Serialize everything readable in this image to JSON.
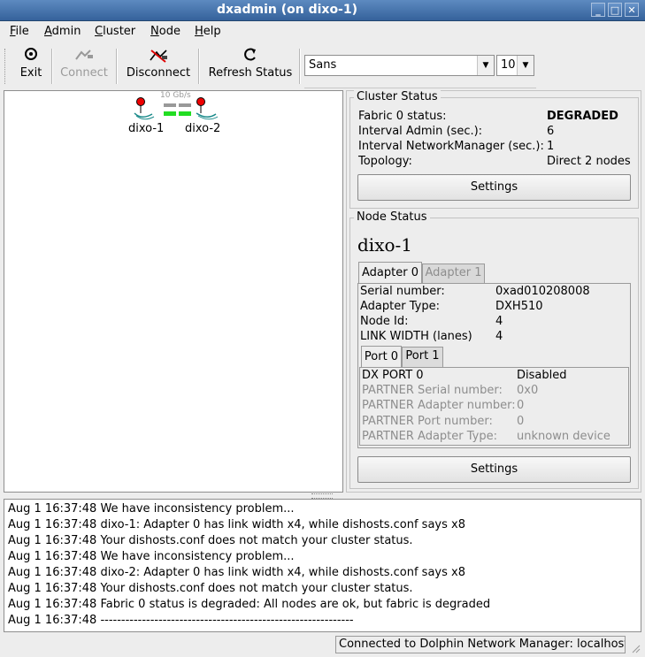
{
  "window": {
    "title": "dxadmin (on dixo-1)"
  },
  "menu": [
    {
      "mnemonic": "F",
      "rest": "ile"
    },
    {
      "mnemonic": "A",
      "rest": "dmin"
    },
    {
      "mnemonic": "C",
      "rest": "luster"
    },
    {
      "mnemonic": "N",
      "rest": "ode"
    },
    {
      "mnemonic": "H",
      "rest": "elp"
    }
  ],
  "toolbar": {
    "exit": "Exit",
    "connect": "Connect",
    "disconnect": "Disconnect",
    "refresh": "Refresh Status",
    "font_family": "Sans",
    "font_size": "10"
  },
  "topology": {
    "link_label": "10 Gb/s",
    "node1": "dixo-1",
    "node2": "dixo-2",
    "link_color": "#22dd22"
  },
  "cluster_status": {
    "title": "Cluster Status",
    "rows": [
      {
        "label": "Fabric 0 status:",
        "value": "DEGRADED"
      },
      {
        "label": "Interval Admin (sec.):",
        "value": "6"
      },
      {
        "label": "Interval NetworkManager (sec.):",
        "value": "1"
      },
      {
        "label": "Topology:",
        "value": "Direct 2 nodes"
      }
    ],
    "settings": "Settings"
  },
  "node_status": {
    "title": "Node Status",
    "node_name": "dixo-1",
    "adapter_tabs": [
      "Adapter 0",
      "Adapter 1"
    ],
    "adapter_rows": [
      {
        "label": "Serial number:",
        "value": "0xad010208008"
      },
      {
        "label": "Adapter Type:",
        "value": "DXH510"
      },
      {
        "label": "Node Id:",
        "value": "4"
      },
      {
        "label": "LINK WIDTH (lanes)",
        "value": "4"
      }
    ],
    "port_tabs": [
      "Port 0",
      "Port 1"
    ],
    "port_rows": [
      {
        "label": "DX PORT 0",
        "value": "Disabled"
      },
      {
        "label": "PARTNER Serial number:",
        "value": "0x0"
      },
      {
        "label": "PARTNER Adapter number:",
        "value": "0"
      },
      {
        "label": "PARTNER Port number:",
        "value": "0"
      },
      {
        "label": "PARTNER Adapter Type:",
        "value": "unknown device"
      }
    ],
    "settings": "Settings"
  },
  "log": [
    "Aug  1 16:37:48 We have inconsistency problem...",
    "Aug  1 16:37:48 dixo-1: Adapter 0 has link width x4, while dishosts.conf says x8",
    "Aug  1 16:37:48 Your dishosts.conf does not match your cluster status.",
    "Aug  1 16:37:48 We have inconsistency problem...",
    "Aug  1 16:37:48 dixo-2: Adapter 0 has link width x4, while dishosts.conf says x8",
    "Aug  1 16:37:48 Your dishosts.conf does not match your cluster status.",
    "Aug  1 16:37:48 Fabric 0 status is degraded: All nodes are ok, but fabric is degraded",
    "Aug  1 16:37:48 -------------------------------------------------------------"
  ],
  "statusbar": "Connected to Dolphin Network Manager: localhost"
}
